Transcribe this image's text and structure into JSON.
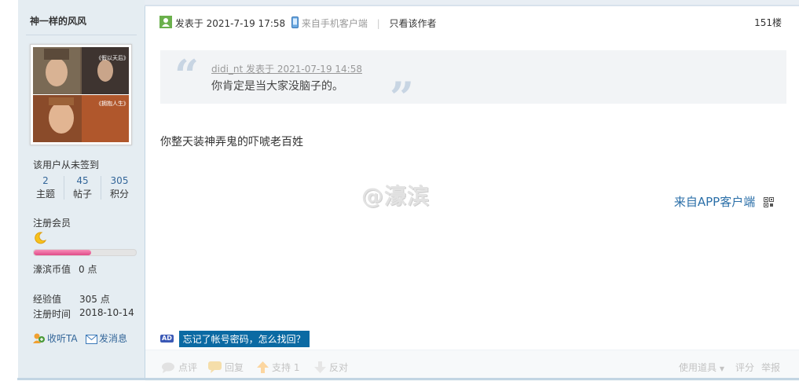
{
  "author": {
    "name": "神一样的风风",
    "signin_status": "该用户从未签到",
    "stats": [
      {
        "value": "2",
        "label": "主题"
      },
      {
        "value": "45",
        "label": "帖子"
      },
      {
        "value": "305",
        "label": "积分"
      }
    ],
    "group": "注册会员",
    "level_progress": 0.56,
    "coin_label": "濠滨币值",
    "coin_value": "0 点",
    "exp_label": "经验值",
    "exp_value": "305 点",
    "reg_label": "注册时间",
    "reg_value": "2018-10-14",
    "follow_label": "收听TA",
    "message_label": "发消息",
    "avatar_captions": [
      "《假以天后》",
      "《拥抱人生》"
    ]
  },
  "post": {
    "posted_label": "发表于 2021-7-19 17:58",
    "client_label": "来自手机客户端",
    "only_author_label": "只看该作者",
    "floor": "151楼",
    "quote": {
      "meta": "didi_nt 发表于 2021-07-19 14:58",
      "text": "你肯定是当大家没脑子的。"
    },
    "content": "你整天装神弄鬼的吓唬老百姓",
    "watermark": "@濠滨",
    "app_link": "来自APP客户端",
    "ad_tag": "AD",
    "ad_text": "忘记了帐号密码，怎么找回？"
  },
  "footer": {
    "comment": "点评",
    "reply": "回复",
    "support": "支持 1",
    "oppose": "反对",
    "tools": "使用道具",
    "rate": "评分",
    "report": "举报"
  },
  "colors": {
    "link": "#336699",
    "sidebar_bg": "#e5edf2",
    "ad_bg": "#0b6aa3"
  }
}
